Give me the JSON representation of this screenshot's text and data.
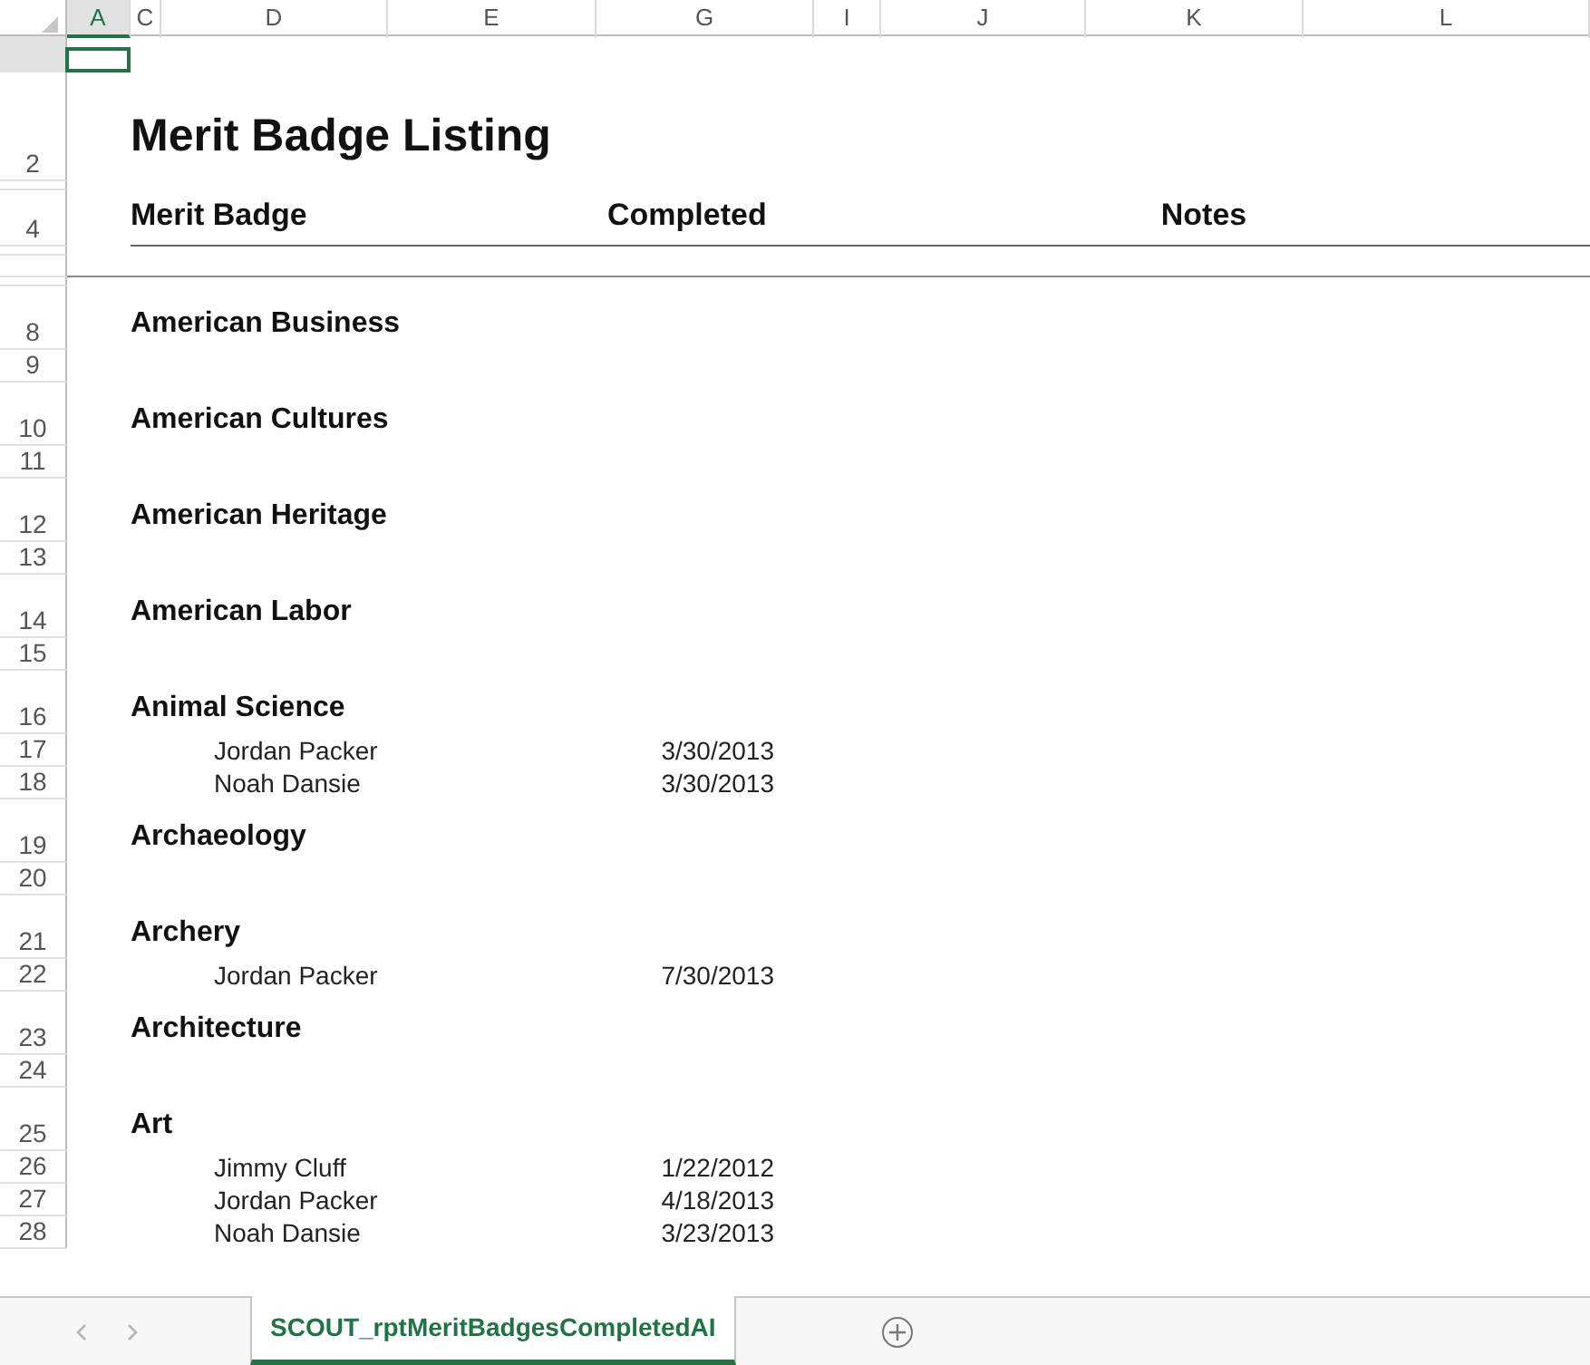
{
  "column_headers": [
    {
      "label": "A",
      "selected": true
    },
    {
      "label": "C",
      "selected": false
    },
    {
      "label": "D",
      "selected": false
    },
    {
      "label": "E",
      "selected": false
    },
    {
      "label": "G",
      "selected": false
    },
    {
      "label": "I",
      "selected": false
    },
    {
      "label": "J",
      "selected": false
    },
    {
      "label": "K",
      "selected": false
    },
    {
      "label": "L",
      "selected": false
    }
  ],
  "rows": [
    {
      "kind": "active"
    },
    {
      "kind": "title",
      "number": "2",
      "text": "Merit Badge Listing"
    },
    {
      "kind": "gap"
    },
    {
      "kind": "header",
      "number": "4",
      "columns": [
        "Merit Badge",
        "Completed",
        "Notes"
      ]
    },
    {
      "kind": "gap"
    },
    {
      "kind": "rule"
    },
    {
      "kind": "gap"
    },
    {
      "kind": "badge",
      "number": "8",
      "text": "American Business"
    },
    {
      "kind": "blank",
      "number": "9"
    },
    {
      "kind": "badge",
      "number": "10",
      "text": "American Cultures"
    },
    {
      "kind": "blank",
      "number": "11"
    },
    {
      "kind": "badge",
      "number": "12",
      "text": "American Heritage"
    },
    {
      "kind": "blank",
      "number": "13"
    },
    {
      "kind": "badge",
      "number": "14",
      "text": "American Labor"
    },
    {
      "kind": "blank",
      "number": "15"
    },
    {
      "kind": "badge",
      "number": "16",
      "text": "Animal Science"
    },
    {
      "kind": "person",
      "number": "17",
      "name": "Jordan Packer",
      "date": "3/30/2013"
    },
    {
      "kind": "person",
      "number": "18",
      "name": "Noah Dansie",
      "date": "3/30/2013"
    },
    {
      "kind": "badge",
      "number": "19",
      "text": "Archaeology"
    },
    {
      "kind": "blank",
      "number": "20"
    },
    {
      "kind": "badge",
      "number": "21",
      "text": "Archery"
    },
    {
      "kind": "person",
      "number": "22",
      "name": "Jordan Packer",
      "date": "7/30/2013"
    },
    {
      "kind": "badge",
      "number": "23",
      "text": "Architecture"
    },
    {
      "kind": "blank",
      "number": "24"
    },
    {
      "kind": "badge",
      "number": "25",
      "text": "Art"
    },
    {
      "kind": "person",
      "number": "26",
      "name": "Jimmy Cluff",
      "date": "1/22/2012"
    },
    {
      "kind": "person",
      "number": "27",
      "name": "Jordan Packer",
      "date": "4/18/2013"
    },
    {
      "kind": "person",
      "number": "28",
      "name": "Noah Dansie",
      "date": "3/23/2013"
    }
  ],
  "sheet_tabs": [
    {
      "label": "SCOUT_rptMeritBadgesCompletedAI",
      "selected": true
    }
  ]
}
